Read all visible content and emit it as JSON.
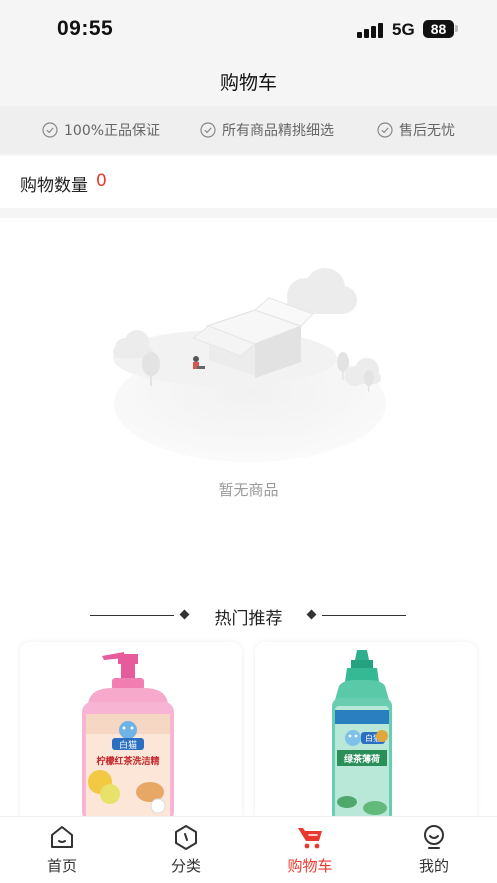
{
  "status_bar": {
    "time": "09:55",
    "network": "5G",
    "battery": "88"
  },
  "header": {
    "title": "购物车"
  },
  "guarantees": [
    {
      "icon": "check-circle-icon",
      "text": "100%正品保证"
    },
    {
      "icon": "check-circle-icon",
      "text": "所有商品精挑细选"
    },
    {
      "icon": "check-circle-icon",
      "text": "售后无忧"
    }
  ],
  "cart": {
    "count_label": "购物数量",
    "count_value": "0",
    "empty_text": "暂无商品"
  },
  "recommend": {
    "title": "热门推荐",
    "products": [
      {
        "image": "pink-dish-soap-bottle",
        "brand": "白猫",
        "name": "柠檬红茶洗洁精"
      },
      {
        "image": "green-dish-soap-bottle",
        "brand": "白猫",
        "name": "绿茶薄荷"
      }
    ]
  },
  "tab_bar": {
    "tabs": [
      {
        "label": "首页",
        "icon": "home-icon"
      },
      {
        "label": "分类",
        "icon": "category-icon"
      },
      {
        "label": "购物车",
        "icon": "cart-icon",
        "active": true
      },
      {
        "label": "我的",
        "icon": "profile-icon"
      }
    ]
  },
  "colors": {
    "accent": "#e8382f",
    "background": "#f5f5f5",
    "muted_text": "#9a9a9a"
  }
}
